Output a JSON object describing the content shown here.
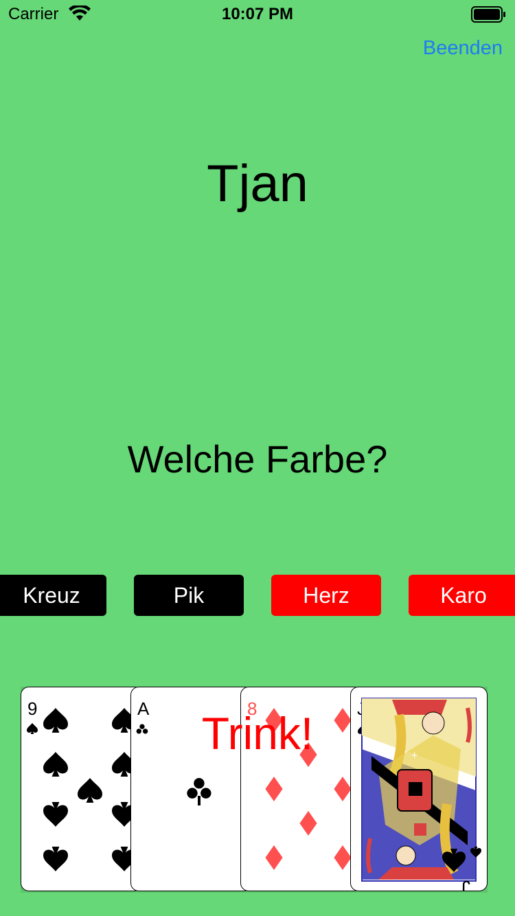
{
  "status_bar": {
    "carrier": "Carrier",
    "time": "10:07 PM"
  },
  "nav": {
    "quit_label": "Beenden"
  },
  "game": {
    "player_name": "Tjan",
    "question": "Welche Farbe?",
    "suit_buttons": [
      "Kreuz",
      "Pik",
      "Herz",
      "Karo"
    ],
    "result": "Trink!"
  },
  "cards": [
    {
      "rank": "9",
      "suit": "spades"
    },
    {
      "rank": "A",
      "suit": "clubs"
    },
    {
      "rank": "8",
      "suit": "diamonds"
    },
    {
      "rank": "J",
      "suit": "spades"
    }
  ],
  "colors": {
    "background": "#66d877",
    "accent": "#1e7cf2",
    "button_black": "#000000",
    "button_red": "#ff0000",
    "result_text": "#ff0000"
  }
}
